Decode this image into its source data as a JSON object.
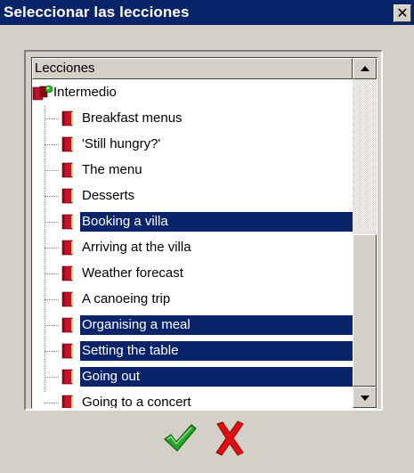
{
  "window": {
    "title": "Seleccionar las lecciones",
    "close_label": "✕"
  },
  "tree": {
    "column_header": "Lecciones",
    "root": {
      "label": "Intermedio"
    },
    "items": [
      {
        "label": "Breakfast menus",
        "selected": false
      },
      {
        "label": "'Still hungry?'",
        "selected": false
      },
      {
        "label": "The menu",
        "selected": false
      },
      {
        "label": "Desserts",
        "selected": false
      },
      {
        "label": "Booking a villa",
        "selected": true
      },
      {
        "label": "Arriving at the villa",
        "selected": false
      },
      {
        "label": "Weather forecast",
        "selected": false
      },
      {
        "label": "A canoeing trip",
        "selected": false
      },
      {
        "label": "Organising a meal",
        "selected": true
      },
      {
        "label": "Setting the table",
        "selected": true
      },
      {
        "label": "Going out",
        "selected": true
      },
      {
        "label": "Going to a concert",
        "selected": false
      }
    ]
  },
  "colors": {
    "titlebar": "#0a246a",
    "selection": "#0a246a",
    "ok": "#2aa52a",
    "cancel": "#e01010"
  },
  "icons": {
    "lesson": "book-icon",
    "root": "book-folder-icon",
    "ok": "checkmark-icon",
    "cancel": "cross-icon"
  }
}
